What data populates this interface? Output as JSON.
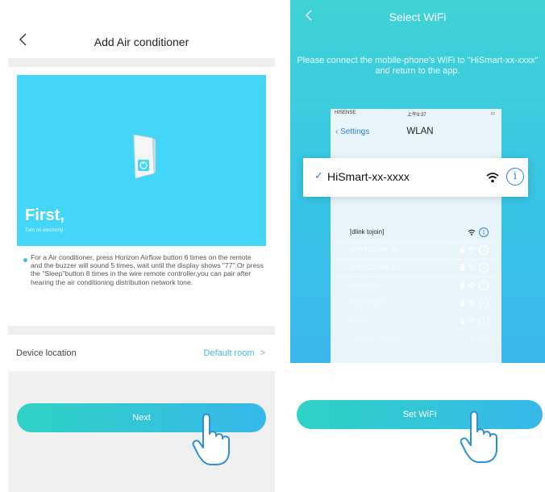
{
  "left": {
    "header": {
      "title": "Add Air conditioner"
    },
    "hero": {
      "heading": "First,",
      "subheading": "Turn on electricity"
    },
    "instructions": "For a Air conditioner, press Horizon Airflow button 6 times on the remote and the buzzer will sound 5 times, wait until the display shows \"77\".Or  press the \"Sleep\"button 8 times in the wire remote controller,you can pair after hearing the air conditioning distribution network tone.",
    "location": {
      "label": "Device location",
      "value": "Default room",
      "chevron": ">"
    },
    "next_button": {
      "label": "Next"
    }
  },
  "right": {
    "header": {
      "title": "Select WiFi"
    },
    "instruction": "Please connect the mobile-phone's WiFi to \"HiSmart-xx-xxxx\" and return to the app.",
    "phone": {
      "status": {
        "carrier": "HISENSE",
        "time": "上午9:37"
      },
      "nav": {
        "back": "Settings",
        "title": "WLAN"
      }
    },
    "selected_network": {
      "ssid": "HiSmart-xx-xxxx"
    },
    "networks": [
      {
        "name": "[dlink tojoin]",
        "locked": false
      },
      {
        "name": "@PHICOMM_20",
        "locked": true
      },
      {
        "name": "@PHICOMM_2A",
        "locked": true
      },
      {
        "name": "101-online",
        "locked": true
      },
      {
        "name": "AUTOTEST",
        "locked": true
      },
      {
        "name": "dd-wrt",
        "locked": true
      },
      {
        "name": "Hisense_101897",
        "locked": false
      }
    ],
    "set_wifi_button": {
      "label": "Set WiFi"
    }
  },
  "colors": {
    "accent": "#37b8ea",
    "teal": "#2fd2c4",
    "hero_blue": "#44d6f8",
    "ios_blue": "#2c83e6"
  }
}
